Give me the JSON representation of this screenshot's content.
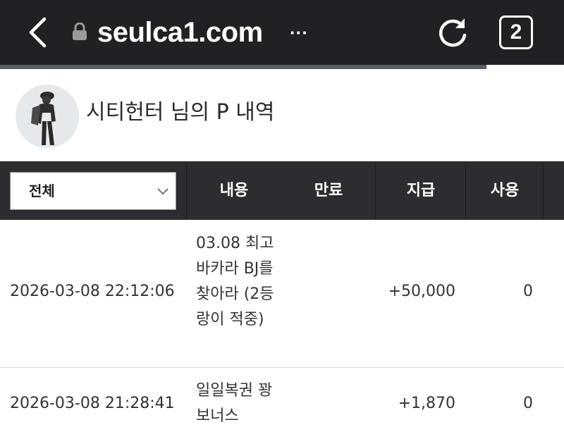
{
  "browser": {
    "url": "seulca1.com",
    "more_indicator": "···",
    "tab_count": "2"
  },
  "profile": {
    "title": "시티헌터 님의 P 내역"
  },
  "table": {
    "filter_selected": "전체",
    "headers": {
      "content": "내용",
      "expire": "만료",
      "give": "지급",
      "use": "사용"
    },
    "rows": [
      {
        "date": "2026-03-08 22:12:06",
        "content": "03.08 최고바카라 BJ를 찾아라 (2등 랑이 적중)",
        "expire": "",
        "give": "+50,000",
        "use": "0"
      },
      {
        "date": "2026-03-08 21:28:41",
        "content": "일일복권 꽝 보너스",
        "expire": "",
        "give": "+1,870",
        "use": "0"
      }
    ]
  },
  "colors": {
    "browser_bar": "#1f2124",
    "table_header": "#2c2d30",
    "progress": "#5a5d61"
  }
}
